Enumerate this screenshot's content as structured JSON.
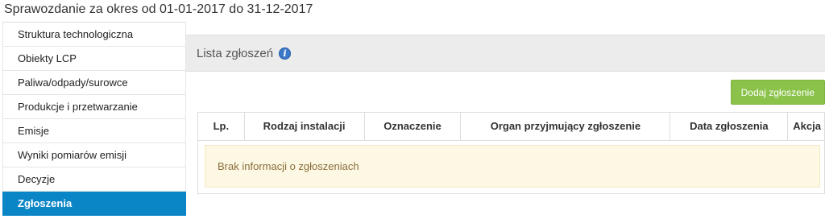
{
  "page_title": "Sprawozdanie za okres od 01-01-2017 do 31-12-2017",
  "sidebar": {
    "items": [
      {
        "label": "Struktura technologiczna"
      },
      {
        "label": "Obiekty LCP"
      },
      {
        "label": "Paliwa/odpady/surowce"
      },
      {
        "label": "Produkcje i przetwarzanie"
      },
      {
        "label": "Emisje"
      },
      {
        "label": "Wyniki pomiarów emisji"
      },
      {
        "label": "Decyzje"
      },
      {
        "label": "Zgłoszenia",
        "active": true
      }
    ]
  },
  "panel": {
    "title": "Lista zgłoszeń",
    "info_icon": "info-icon",
    "add_button_label": "Dodaj zgłoszenie"
  },
  "table": {
    "columns": [
      "Lp.",
      "Rodzaj instalacji",
      "Oznaczenie",
      "Organ przyjmujący zgłoszenie",
      "Data zgłoszenia",
      "Akcja"
    ],
    "empty_message": "Brak informacji o zgłoszeniach"
  },
  "colors": {
    "active_item": "#0a86c6",
    "add_button": "#8bc34a",
    "empty_bg": "#fcf8e3"
  }
}
